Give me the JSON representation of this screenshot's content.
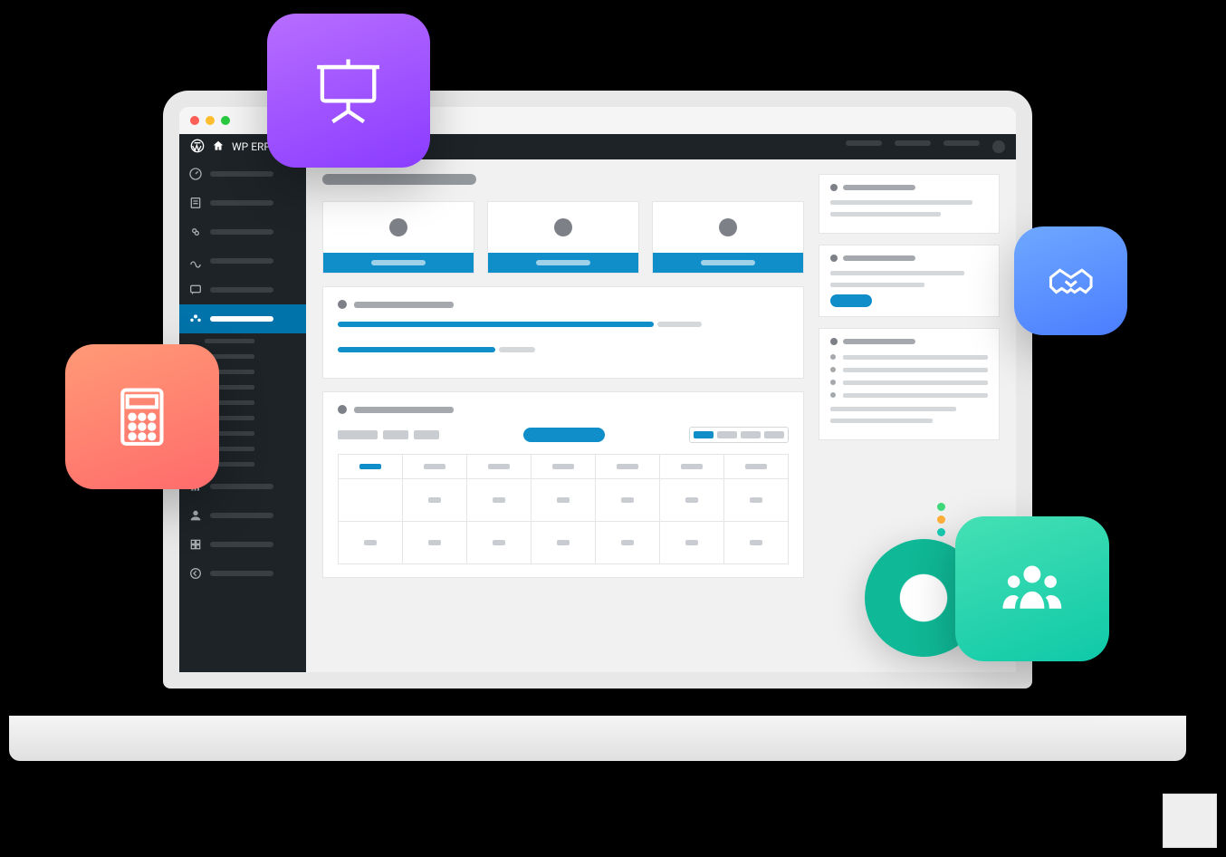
{
  "adminbar": {
    "site_name": "WP ERP"
  },
  "sidebar": {
    "items": [
      {
        "icon": "dashboard-icon"
      },
      {
        "icon": "posts-icon"
      },
      {
        "icon": "media-icon"
      },
      {
        "icon": "pages-icon"
      },
      {
        "icon": "comments-icon"
      },
      {
        "icon": "erp-icon",
        "active": true
      },
      {
        "icon": "chart-icon"
      },
      {
        "icon": "users-icon"
      },
      {
        "icon": "tools-icon"
      },
      {
        "icon": "settings-icon"
      }
    ]
  },
  "colors": {
    "accent": "#0f8ec9",
    "purple": "#8a3cff",
    "blue": "#4b7dff",
    "orange": "#ff6b6b",
    "teal": "#0fc9a8"
  },
  "bubbles": {
    "purple": "presentation-icon",
    "blue": "handshake-icon",
    "orange": "calculator-icon",
    "teal": "people-icon"
  }
}
